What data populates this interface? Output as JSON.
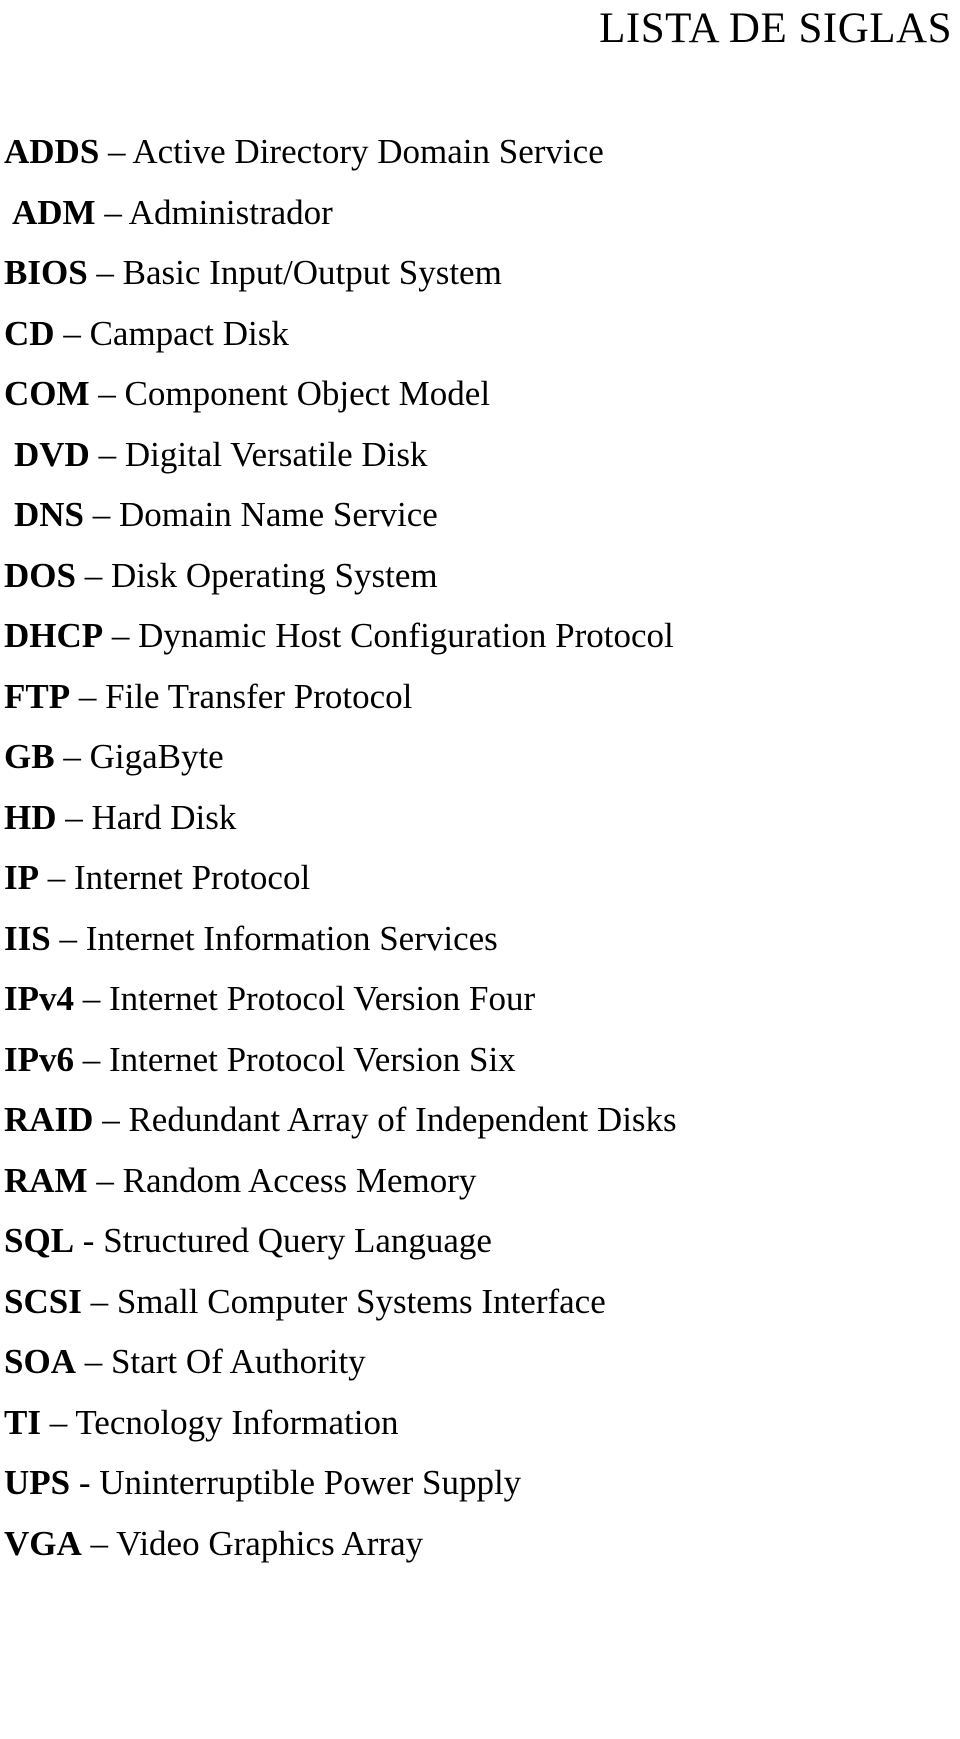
{
  "document": {
    "title": "LISTA DE SIGLAS",
    "entries": [
      {
        "abbr": "ADDS",
        "sep": "–",
        "expansion": "Active Directory Domain Service"
      },
      {
        "abbr": "ADM",
        "sep": "–",
        "expansion": "Administrador"
      },
      {
        "abbr": "BIOS",
        "sep": "–",
        "expansion": "Basic Input/Output System"
      },
      {
        "abbr": "CD",
        "sep": "–",
        "expansion": "Campact Disk"
      },
      {
        "abbr": "COM",
        "sep": "–",
        "expansion": "Component Object Model"
      },
      {
        "abbr": "DVD",
        "sep": "–",
        "expansion": "Digital Versatile Disk"
      },
      {
        "abbr": "DNS",
        "sep": "–",
        "expansion": "Domain Name Service"
      },
      {
        "abbr": "DOS",
        "sep": "–",
        "expansion": "Disk Operating System"
      },
      {
        "abbr": "DHCP",
        "sep": "–",
        "expansion": "Dynamic Host Configuration Protocol"
      },
      {
        "abbr": "FTP",
        "sep": "–",
        "expansion": "File Transfer Protocol"
      },
      {
        "abbr": "GB",
        "sep": "–",
        "expansion": "GigaByte"
      },
      {
        "abbr": "HD",
        "sep": "–",
        "expansion": "Hard Disk"
      },
      {
        "abbr": "IP",
        "sep": "–",
        "expansion": "Internet Protocol"
      },
      {
        "abbr": "IIS",
        "sep": "–",
        "expansion": "Internet Information Services"
      },
      {
        "abbr": "IPv4",
        "sep": "–",
        "expansion": "Internet Protocol Version Four"
      },
      {
        "abbr": "IPv6",
        "sep": "–",
        "expansion": "Internet Protocol Version Six"
      },
      {
        "abbr": "RAID",
        "sep": "–",
        "expansion": "Redundant Array of Independent Disks"
      },
      {
        "abbr": "RAM",
        "sep": "–",
        "expansion": "Random Access Memory"
      },
      {
        "abbr": "SQL",
        "sep": "-",
        "expansion": "Structured Query Language"
      },
      {
        "abbr": "SCSI",
        "sep": "–",
        "expansion": "Small Computer Systems Interface"
      },
      {
        "abbr": "SOA",
        "sep": "–",
        "expansion": "Start Of Authority"
      },
      {
        "abbr": "TI",
        "sep": "–",
        "expansion": "Tecnology Information"
      },
      {
        "abbr": "UPS",
        "sep": "-",
        "expansion": "Uninterruptible Power Supply"
      },
      {
        "abbr": "VGA",
        "sep": "–",
        "expansion": "Video Graphics Array"
      }
    ]
  }
}
